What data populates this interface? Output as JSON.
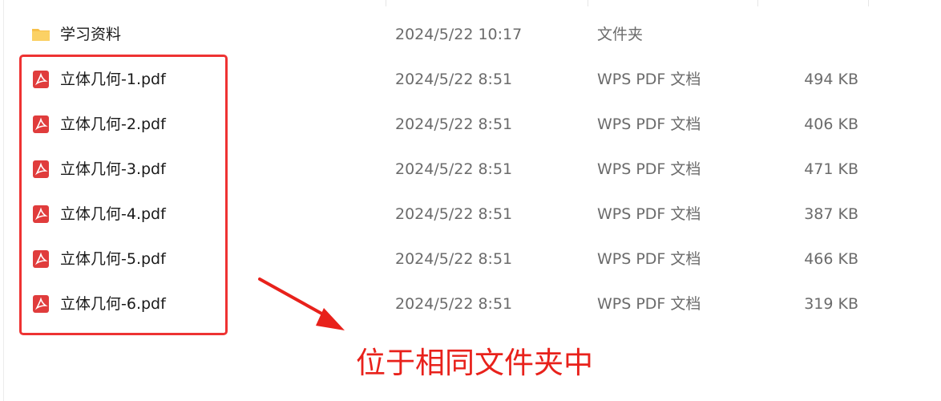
{
  "colors": {
    "highlight": "#ee3333",
    "annotation": "#e8211b",
    "meta_text": "#6b6b6b",
    "folder": "#f7c04a",
    "pdf": "#e03c3c"
  },
  "files": [
    {
      "name": "学习资料",
      "date": "2024/5/22 10:17",
      "type": "文件夹",
      "size": "",
      "icon": "folder-icon"
    },
    {
      "name": "立体几何-1.pdf",
      "date": "2024/5/22 8:51",
      "type": "WPS PDF 文档",
      "size": "494 KB",
      "icon": "pdf-icon"
    },
    {
      "name": "立体几何-2.pdf",
      "date": "2024/5/22 8:51",
      "type": "WPS PDF 文档",
      "size": "406 KB",
      "icon": "pdf-icon"
    },
    {
      "name": "立体几何-3.pdf",
      "date": "2024/5/22 8:51",
      "type": "WPS PDF 文档",
      "size": "471 KB",
      "icon": "pdf-icon"
    },
    {
      "name": "立体几何-4.pdf",
      "date": "2024/5/22 8:51",
      "type": "WPS PDF 文档",
      "size": "387 KB",
      "icon": "pdf-icon"
    },
    {
      "name": "立体几何-5.pdf",
      "date": "2024/5/22 8:51",
      "type": "WPS PDF 文档",
      "size": "466 KB",
      "icon": "pdf-icon"
    },
    {
      "name": "立体几何-6.pdf",
      "date": "2024/5/22 8:51",
      "type": "WPS PDF 文档",
      "size": "319 KB",
      "icon": "pdf-icon"
    }
  ],
  "annotation": {
    "text": "位于相同文件夹中"
  }
}
